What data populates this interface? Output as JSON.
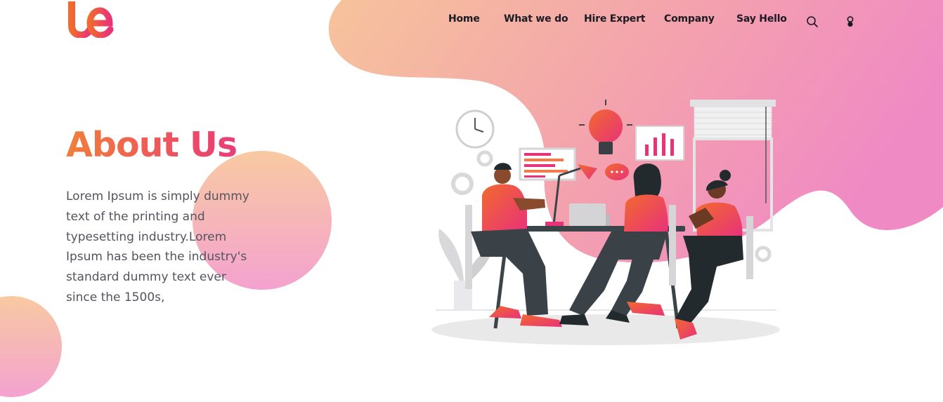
{
  "brand": {
    "logo_text": "te"
  },
  "nav": {
    "items": [
      {
        "label": "Home"
      },
      {
        "label": "What we do"
      },
      {
        "label": "Hire Expert"
      },
      {
        "label": "Company"
      },
      {
        "label": "Say Hello"
      }
    ],
    "icons": [
      "search-icon",
      "theme-toggle-icon"
    ]
  },
  "hero": {
    "title": "About Us",
    "description": "Lorem Ipsum is simply dummy text of the printing and typesetting industry.Lorem Ipsum has been the industry's standard dummy text ever since the 1500s,"
  },
  "colors": {
    "gradient_start": "#f6c39b",
    "gradient_end": "#f08ac4",
    "accent_orange": "#f0803a",
    "accent_pink": "#e4338a",
    "text_dark": "#1b1b24",
    "text_body": "#54545e"
  }
}
